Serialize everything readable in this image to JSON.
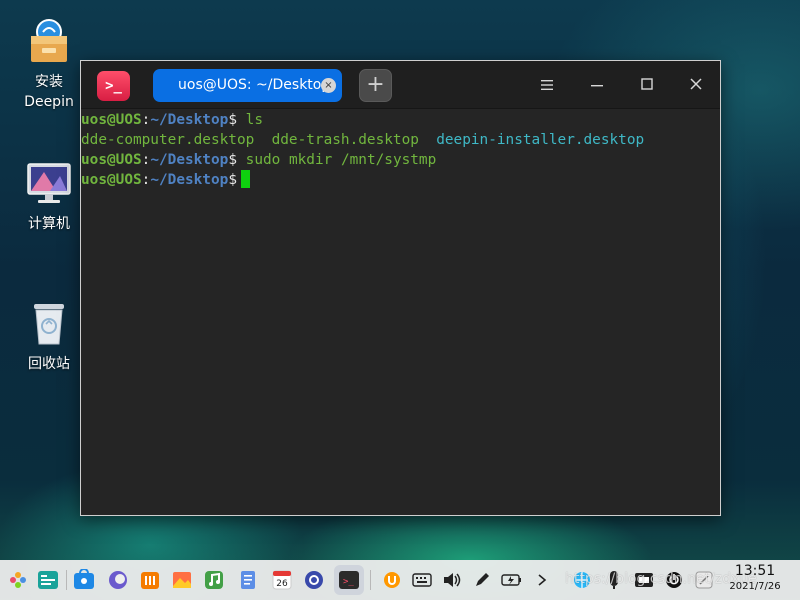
{
  "desktop": {
    "icons": [
      {
        "label": "安装\nDeepin",
        "line1": "安装",
        "line2": "Deepin",
        "icon": "installer-box-icon"
      },
      {
        "label": "计算机",
        "icon": "computer-monitor-icon"
      },
      {
        "label": "回收站",
        "icon": "trash-bin-icon"
      }
    ]
  },
  "terminal": {
    "tab_title": "uos@UOS: ~/Desktop",
    "tab_close_glyph": "×",
    "new_tab_glyph": "+",
    "app_logo_text": ">_",
    "controls": {
      "menu": "☰",
      "minimize": "–",
      "maximize": "□",
      "close": "✕"
    },
    "prompt": {
      "user": "uos@UOS",
      "colon": ":",
      "path": "~/Desktop",
      "dollar": "$"
    },
    "lines": [
      {
        "type": "prompt",
        "command": "ls"
      },
      {
        "type": "output",
        "files": [
          "dde-computer.desktop",
          "dde-trash.desktop",
          "deepin-installer.desktop"
        ]
      },
      {
        "type": "prompt",
        "command": "sudo mkdir /mnt/systmp"
      },
      {
        "type": "prompt",
        "command": ""
      }
    ],
    "colors": {
      "prompt_user": "#71b63e",
      "prompt_path": "#4f82c3",
      "cursor": "#0fd00f",
      "file_alt": "#3fb8c6"
    }
  },
  "taskbar": {
    "apps": [
      "launcher-icon",
      "multitasking-icon",
      "app-store-icon",
      "browser-icon",
      "music-box-icon",
      "photos-icon",
      "music-icon",
      "documents-icon",
      "calendar-icon",
      "settings-icon",
      "terminal-icon"
    ],
    "calendar_day": "26",
    "tray": [
      "input-method-icon",
      "keyboard-icon",
      "volume-icon",
      "pen-icon",
      "battery-icon",
      "expand-arrow-icon",
      "network-icon",
      "notification-icon",
      "screenshot-icon",
      "power-icon",
      "assistant-icon"
    ],
    "watermark": "https://blog.csdn.net/zdxue",
    "clock": {
      "time": "13:51",
      "date": "2021/7/26"
    }
  }
}
